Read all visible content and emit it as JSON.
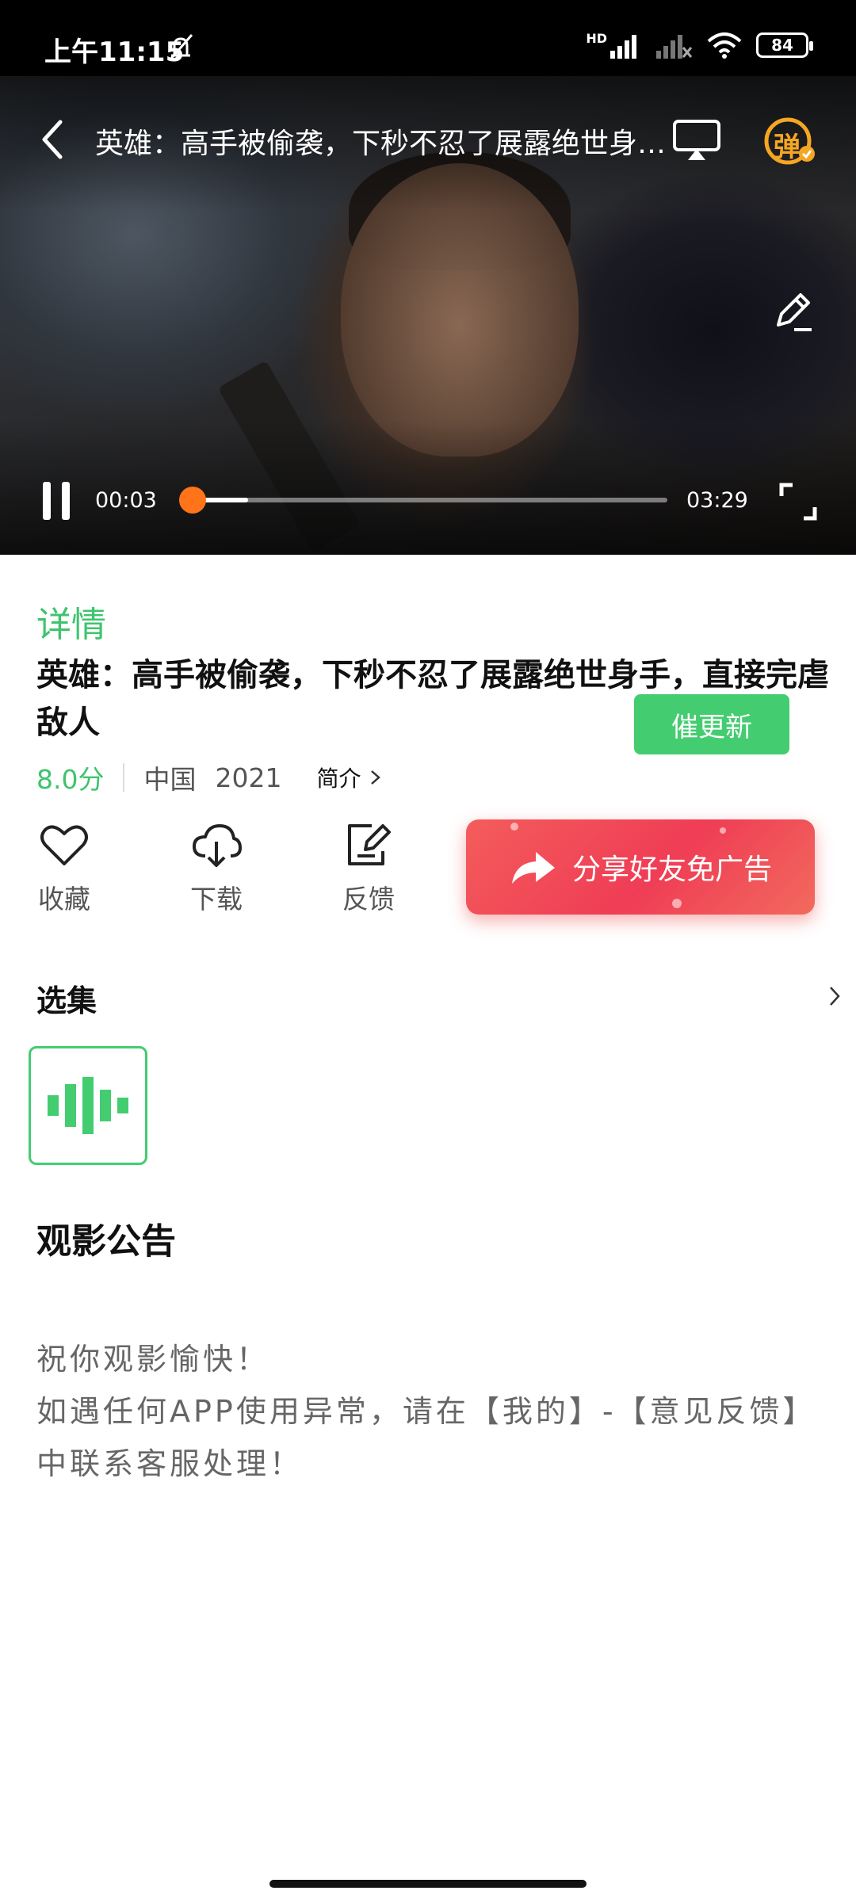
{
  "status_bar": {
    "time": "上午11:15",
    "battery": "84",
    "network_label": "HD",
    "icons": [
      "mute-icon",
      "signal-icon",
      "signal-off-icon",
      "wifi-icon",
      "battery-icon"
    ]
  },
  "player": {
    "title": "英雄：高手被偷袭，下秒不忍了展露绝世身手，直接完虐敌人",
    "current_time": "00:03",
    "total_time": "03:29",
    "progress_fraction": 0.015,
    "danmu_label": "弹",
    "colors": {
      "progress_knob": "#ff7418"
    }
  },
  "detail": {
    "tab_label": "详情",
    "title": "英雄：高手被偷袭，下秒不忍了展露绝世身手，直接完虐敌人",
    "urge_update_label": "催更新",
    "score": "8.0分",
    "region": "中国",
    "year": "2021",
    "intro_label": "简介",
    "actions": [
      {
        "label": "收藏",
        "icon": "heart-icon"
      },
      {
        "label": "下载",
        "icon": "cloud-download-icon"
      },
      {
        "label": "反馈",
        "icon": "feedback-edit-icon"
      }
    ],
    "share_label": "分享好友免广告",
    "colors": {
      "accent": "#44cc70",
      "share_bg": "#ef3d55"
    }
  },
  "episodes": {
    "title": "选集"
  },
  "notice": {
    "title": "观影公告",
    "line1": "祝你观影愉快！",
    "line2": "如遇任何APP使用异常，请在【我的】-【意见反馈】中联系客服处理！"
  }
}
